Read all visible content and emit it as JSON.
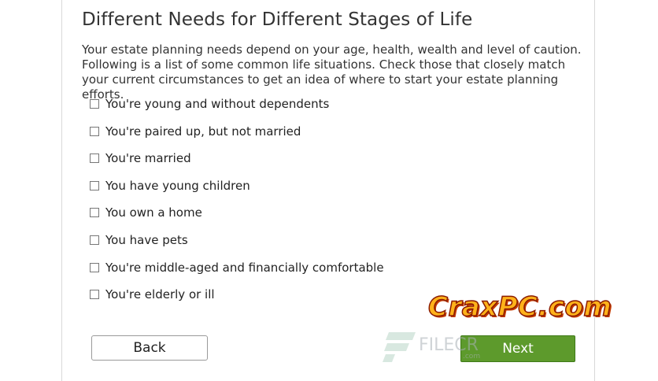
{
  "dialog": {
    "title": "Different Needs for Different Stages of Life",
    "intro": "Your estate planning needs depend on your age, health, wealth and level of caution. Following is a list of some common life situations. Check those that closely match your current circumstances to get an idea of where to start your estate planning efforts."
  },
  "options": [
    {
      "label": "You're young and without dependents",
      "checked": false
    },
    {
      "label": "You're paired up, but not married",
      "checked": false
    },
    {
      "label": "You're married",
      "checked": false
    },
    {
      "label": "You have young children",
      "checked": false
    },
    {
      "label": "You own a home",
      "checked": false
    },
    {
      "label": "You have pets",
      "checked": false
    },
    {
      "label": "You're middle-aged and financially comfortable",
      "checked": false
    },
    {
      "label": "You're elderly or ill",
      "checked": false
    }
  ],
  "buttons": {
    "back_label": "Back",
    "next_label": "Next"
  },
  "watermarks": {
    "crax": "CraxPC.com",
    "filecr": "FILECR",
    "filecr_sub": ".com"
  },
  "colors": {
    "next_button": "#5d9a2c",
    "crax_text": "#ffb21a"
  }
}
